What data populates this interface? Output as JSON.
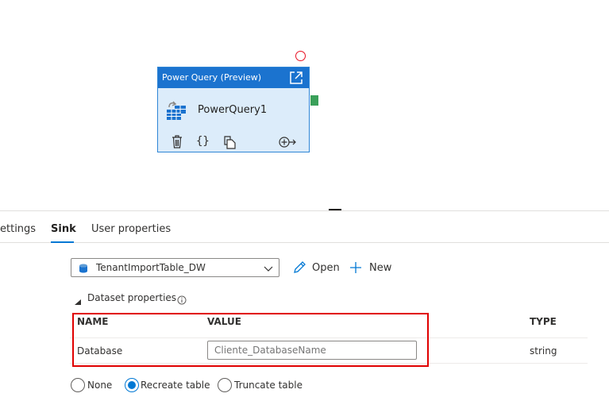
{
  "pipeline": {
    "activity": {
      "type_label": "Power Query (Preview)",
      "name": "PowerQuery1"
    }
  },
  "tabs": [
    {
      "label": "ettings"
    },
    {
      "label": "Sink"
    },
    {
      "label": "User properties"
    }
  ],
  "sink": {
    "dataset": {
      "selected": "TenantImportTable_DW"
    },
    "open_label": "Open",
    "new_label": "New",
    "dataset_properties": {
      "title": "Dataset properties",
      "columns": {
        "name": "NAME",
        "value": "VALUE",
        "type": "TYPE"
      },
      "rows": [
        {
          "name": "Database",
          "value_placeholder": "Cliente_DatabaseName",
          "type": "string"
        }
      ]
    },
    "table_action": {
      "options": [
        {
          "label": "None"
        },
        {
          "label": "Recreate table"
        },
        {
          "label": "Truncate table"
        }
      ],
      "selected": "Recreate table"
    }
  },
  "colors": {
    "accent": "#0078d4",
    "card_header": "#1b73cf",
    "card_body": "#dcecfa",
    "highlight": "#e00000",
    "success_port": "#3aa05a",
    "error_circle": "#e81123"
  }
}
